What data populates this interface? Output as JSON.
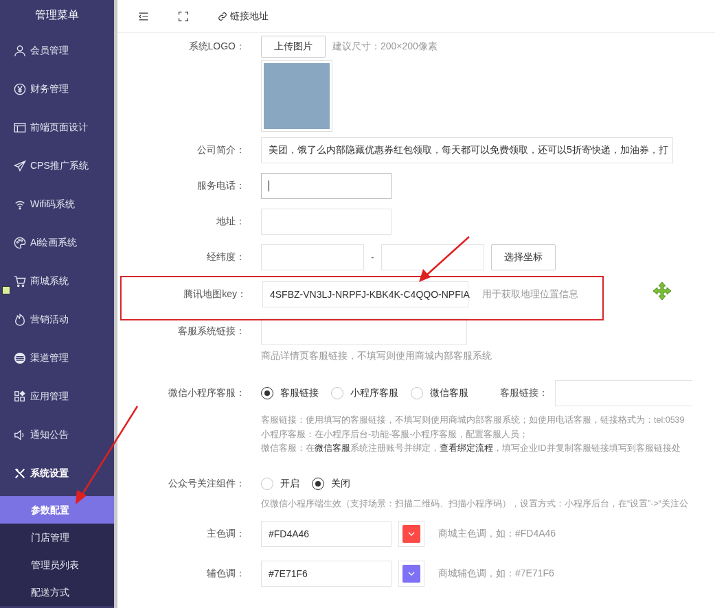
{
  "sidebar": {
    "title": "管理菜单",
    "items": [
      {
        "label": "会员管理",
        "expanded": false
      },
      {
        "label": "财务管理",
        "expanded": false
      },
      {
        "label": "前端页面设计",
        "expanded": false
      },
      {
        "label": "CPS推广系统",
        "expanded": false
      },
      {
        "label": "Wifi码系统",
        "expanded": false
      },
      {
        "label": "Ai绘画系统",
        "expanded": false
      },
      {
        "label": "商城系统",
        "expanded": false
      },
      {
        "label": "营销活动",
        "expanded": false
      },
      {
        "label": "渠道管理",
        "expanded": false
      },
      {
        "label": "应用管理",
        "expanded": false
      },
      {
        "label": "通知公告",
        "expanded": false
      },
      {
        "label": "系统设置",
        "expanded": true
      }
    ],
    "submenu": [
      {
        "label": "参数配置",
        "selected": true
      },
      {
        "label": "门店管理",
        "selected": false
      },
      {
        "label": "管理员列表",
        "selected": false
      },
      {
        "label": "配送方式",
        "selected": false
      }
    ]
  },
  "header": {
    "link_label": "链接地址"
  },
  "form": {
    "logo": {
      "label": "系统LOGO：",
      "button": "上传图片",
      "hint": "建议尺寸：200×200像素"
    },
    "intro": {
      "label": "公司简介：",
      "value": "美团，饿了么内部隐藏优惠券红包领取，每天都可以免费领取，还可以5折寄快递，加油券，打"
    },
    "phone": {
      "label": "服务电话：",
      "focused": true
    },
    "address": {
      "label": "地址："
    },
    "latlng": {
      "label": "经纬度：",
      "separator": "-",
      "button": "选择坐标"
    },
    "map_key": {
      "label": "腾讯地图key：",
      "value": "4SFBZ-VN3LJ-NRPFJ-KBK4K-C4QQO-NPFIA",
      "hint": "用于获取地理位置信息",
      "highlighted": true
    },
    "service_link": {
      "label": "客服系统链接：",
      "hint": "商品详情页客服链接，不填写则使用商城内部客服系统"
    },
    "wechat_service": {
      "label": "微信小程序客服：",
      "options": [
        {
          "label": "客服链接",
          "selected": true
        },
        {
          "label": "小程序客服",
          "selected": false
        },
        {
          "label": "微信客服",
          "selected": false
        }
      ],
      "field_label": "客服链接：",
      "hints": [
        [
          {
            "text": "客服链接：使用填写的客服链接，不填写则使用商城内部客服系统；如使用电话客服，链接格式为：tel:0539",
            "link": false
          }
        ],
        [
          {
            "text": "小程序客服：在小程序后台-功能-客服-小程序客服，配置客服人员；",
            "link": false
          }
        ],
        [
          {
            "text": "微信客服：在",
            "link": false
          },
          {
            "text": "微信客服",
            "link": true
          },
          {
            "text": "系统注册账号并绑定，",
            "link": false
          },
          {
            "text": "查看绑定流程",
            "link": true
          },
          {
            "text": "，填写企业ID并复制客服链接填写到客服链接处",
            "link": false
          }
        ]
      ]
    },
    "follow": {
      "label": "公众号关注组件：",
      "options": [
        {
          "label": "开启",
          "selected": false
        },
        {
          "label": "关闭",
          "selected": true
        }
      ],
      "hint": "仅微信小程序端生效（支持场景：扫描二维码、扫描小程序码），设置方式：小程序后台，在“设置”->“关注公"
    },
    "colors": [
      {
        "label": "主色调：",
        "value": "#FD4A46",
        "color": "#fd4a46",
        "hint": "商城主色调，如：#FD4A46"
      },
      {
        "label": "辅色调：",
        "value": "#7E71F6",
        "color": "#7e71f6",
        "hint": "商城辅色调，如：#7E71F6"
      }
    ]
  }
}
